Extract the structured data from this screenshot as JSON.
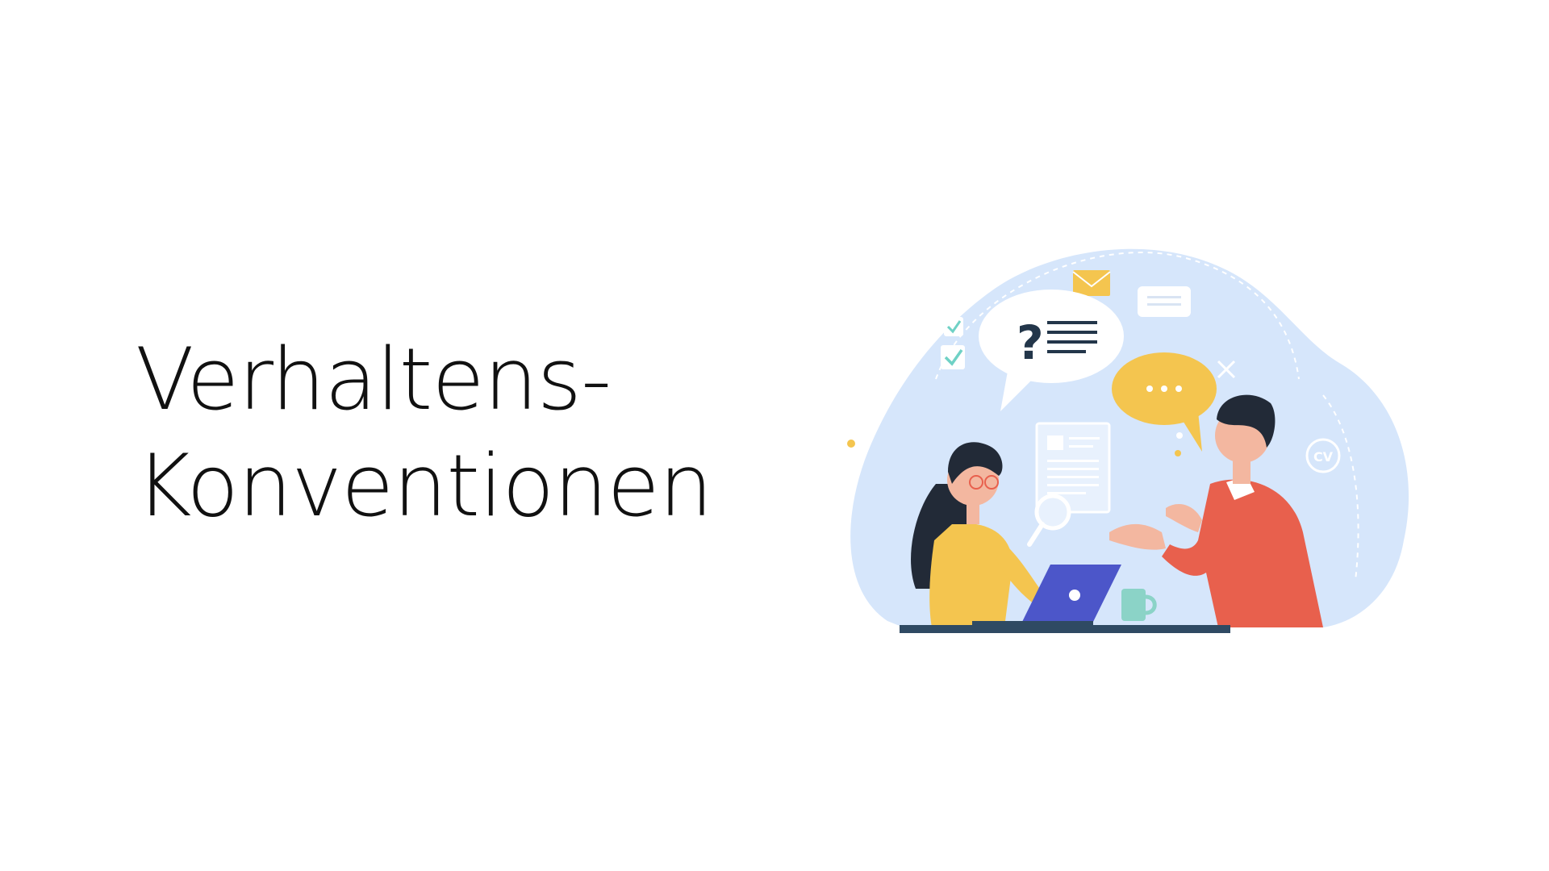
{
  "slide": {
    "title_line_1": "Verhaltens-",
    "title_line_2": "Konventionen"
  },
  "illustration": {
    "badge_cv": "CV",
    "question_mark": "?",
    "icons": [
      "envelope-icon",
      "checkbox-icon",
      "speech-bubble-question",
      "speech-bubble-typing",
      "document-icon",
      "magnifier-icon",
      "laptop-icon",
      "mug-icon"
    ],
    "colors": {
      "blob": "#d6e6fb",
      "yellow": "#f4c54f",
      "jacket": "#e8604d",
      "laptop": "#4c56c9",
      "mug": "#8bd3c7",
      "desk": "#2f4a63"
    }
  }
}
